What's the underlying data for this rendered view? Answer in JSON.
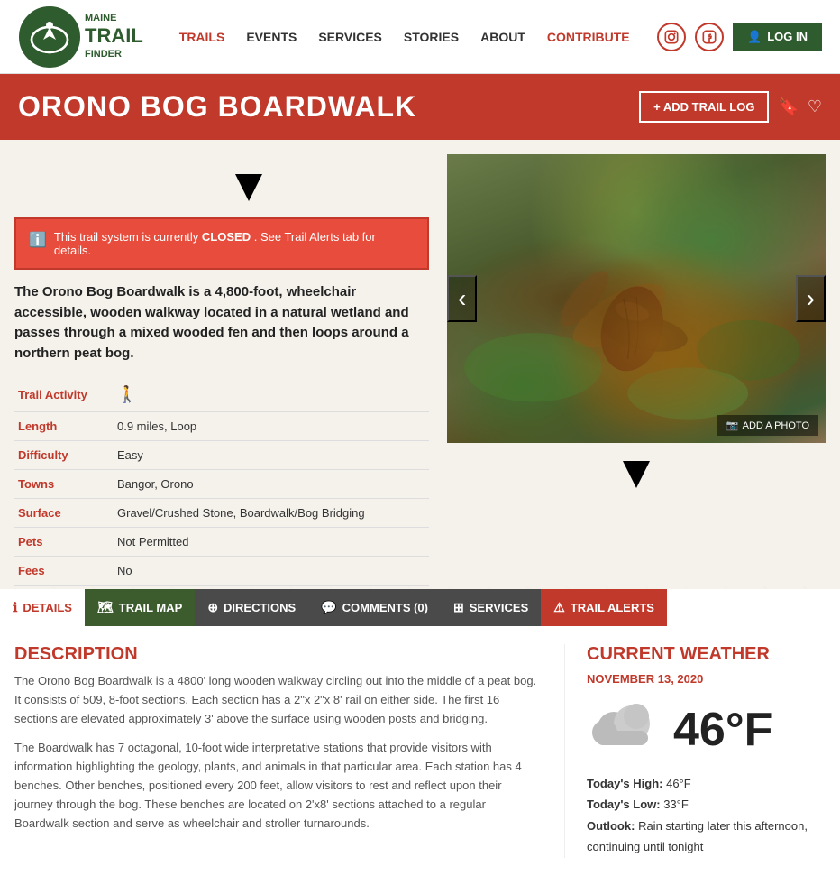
{
  "site": {
    "name": "MAINE TRAIL FINDER",
    "logo_line1": "MAINE",
    "logo_trail": "TRAIL",
    "logo_line3": "FINDER"
  },
  "nav": {
    "items": [
      {
        "label": "TRAILS",
        "active": true
      },
      {
        "label": "EVENTS",
        "active": false
      },
      {
        "label": "SERVICES",
        "active": false
      },
      {
        "label": "STORIES",
        "active": false
      },
      {
        "label": "ABOUT",
        "active": false
      },
      {
        "label": "CONTRIBUTE",
        "active": false,
        "highlight": true
      }
    ],
    "login": "LOG IN"
  },
  "trail": {
    "title": "ORONO BOG BOARDWALK",
    "add_log_label": "+ ADD TRAIL LOG",
    "alert_message": "This trail system is currently",
    "alert_status": "CLOSED",
    "alert_suffix": ". See Trail Alerts tab for details.",
    "description": "The Orono Bog Boardwalk is a 4,800-foot, wheelchair accessible, wooden walkway located in a natural wetland and passes through a mixed wooded fen and then loops around a northern peat bog.",
    "details": [
      {
        "label": "Trail Activity",
        "value": "walk",
        "type": "icon"
      },
      {
        "label": "Length",
        "value": "0.9 miles, Loop"
      },
      {
        "label": "Difficulty",
        "value": "Easy"
      },
      {
        "label": "Towns",
        "value": "Bangor, Orono"
      },
      {
        "label": "Surface",
        "value": "Gravel/Crushed Stone, Boardwalk/Bog Bridging"
      },
      {
        "label": "Pets",
        "value": "Not Permitted"
      },
      {
        "label": "Fees",
        "value": "No"
      }
    ],
    "add_photo_label": "ADD A PHOTO"
  },
  "tabs": [
    {
      "label": "DETAILS",
      "icon": "ℹ",
      "active": true,
      "type": "details"
    },
    {
      "label": "TRAIL MAP",
      "icon": "🗺",
      "type": "map"
    },
    {
      "label": "DIRECTIONS",
      "icon": "⊕",
      "type": "directions"
    },
    {
      "label": "COMMENTS (0)",
      "icon": "💬",
      "type": "comments"
    },
    {
      "label": "SERVICES",
      "icon": "⊞",
      "type": "services"
    },
    {
      "label": "TRAIL ALERTS",
      "icon": "⚠",
      "type": "alerts",
      "alert": true
    }
  ],
  "description_section": {
    "title": "DESCRIPTION",
    "text1": "The Orono Bog Boardwalk is a 4800' long wooden walkway circling out into the middle of a peat bog. It consists of 509, 8-foot sections. Each section has a 2\"x 2\"x 8' rail on either side. The first 16 sections are elevated approximately 3' above the surface using wooden posts and bridging.",
    "text2": "The Boardwalk has 7 octagonal, 10-foot wide interpretative stations that provide visitors with information highlighting the geology, plants, and animals in that particular area. Each station has 4 benches. Other benches, positioned every 200 feet, allow visitors to rest and reflect upon their journey through the bog. These benches are located on 2'x8' sections attached to a regular Boardwalk section and serve as wheelchair and stroller turnarounds."
  },
  "weather": {
    "title": "CURRENT WEATHER",
    "date": "NOVEMBER 13, 2020",
    "temperature": "46°F",
    "high": "46°F",
    "low": "33°F",
    "outlook": "Rain starting later this afternoon, continuing until tonight"
  }
}
